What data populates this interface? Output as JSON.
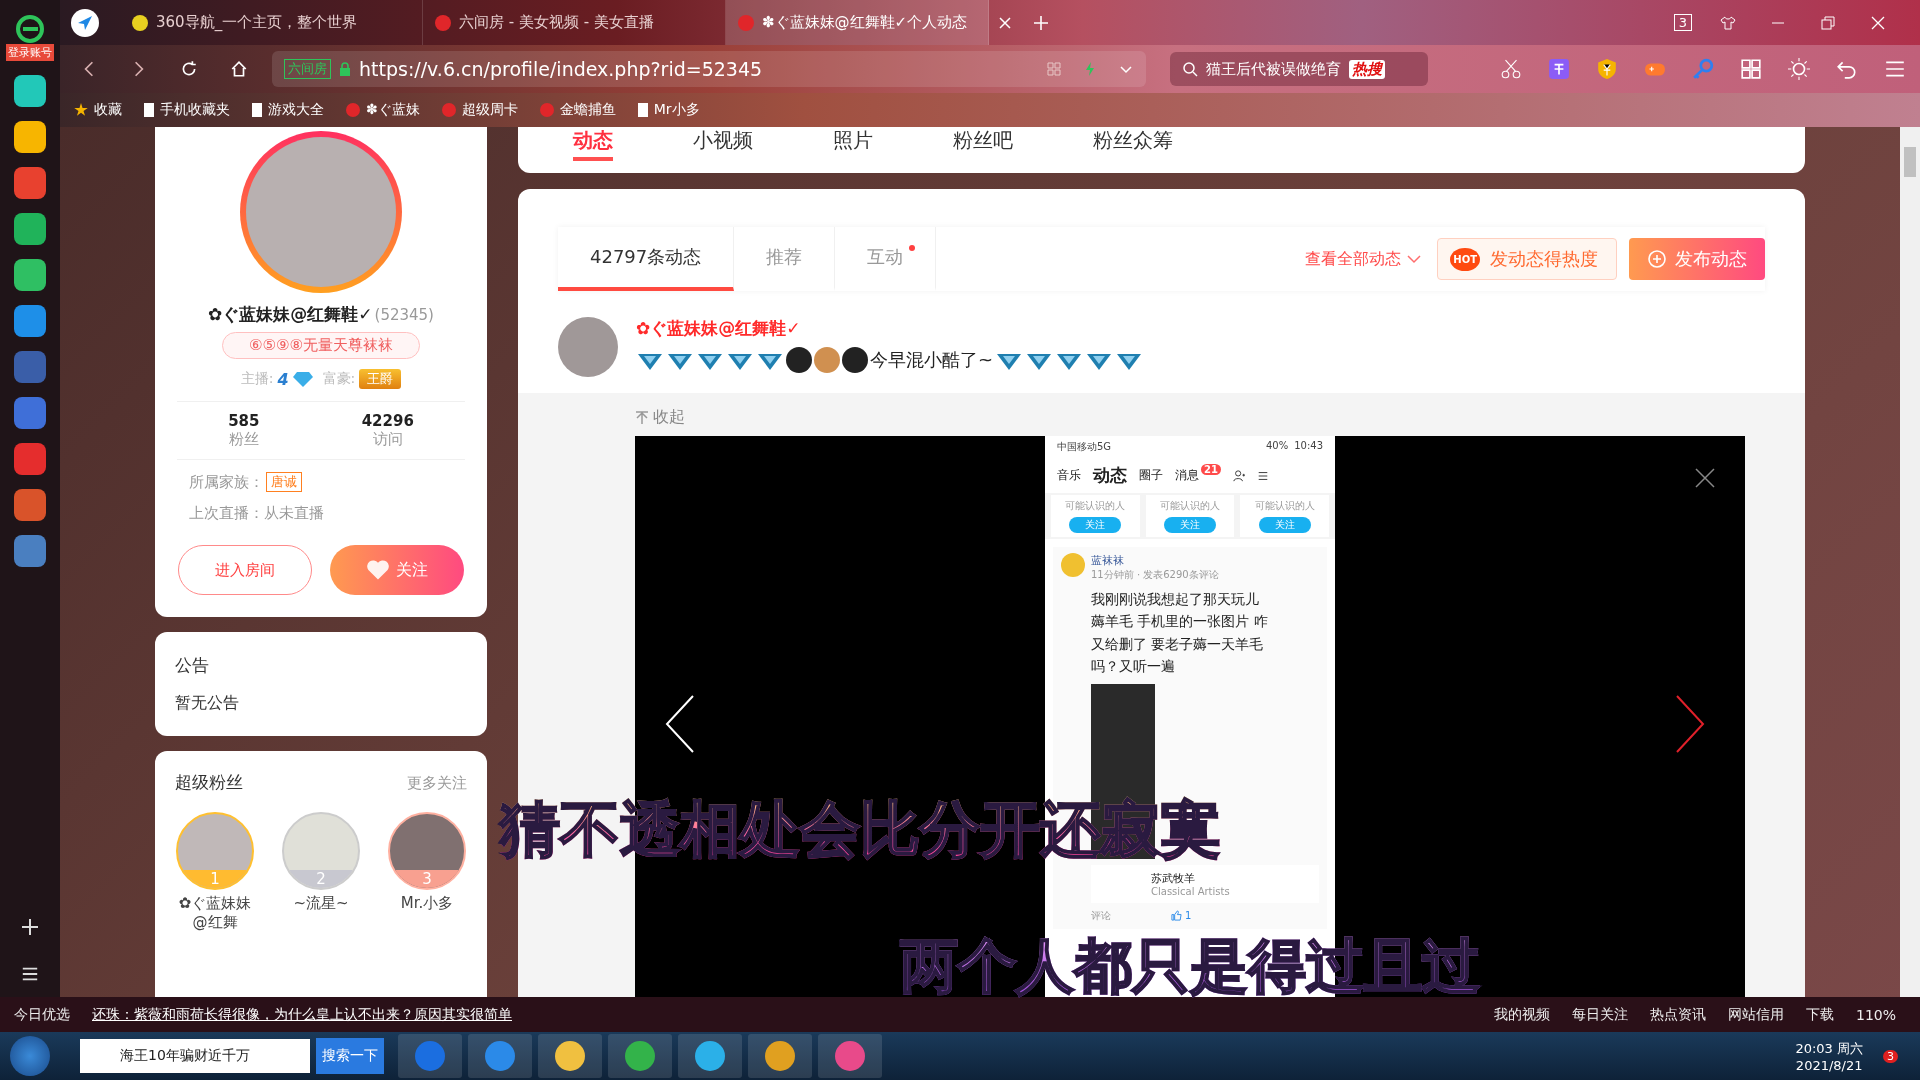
{
  "rail": {
    "login": "登录账号"
  },
  "tabs": [
    {
      "title": "360导航_一个主页，整个世界",
      "selected": false
    },
    {
      "title": "六间房 - 美女视频 - 美女直播",
      "selected": false
    },
    {
      "title": "✽ぐ蓝妹妹@红舞鞋✓个人动态",
      "selected": true
    }
  ],
  "window": {
    "tab_count": "3"
  },
  "address": {
    "cert": "六间房",
    "url": "https://v.6.cn/profile/index.php?rid=52345"
  },
  "search": {
    "value": "猫王后代被误做绝育",
    "hot": "热搜"
  },
  "bookmarks": [
    "收藏",
    "手机收藏夹",
    "游戏大全",
    "✽ぐ蓝妹",
    "超级周卡",
    "金蟾捕鱼",
    "Mr小多"
  ],
  "site_nav": [
    {
      "label": "动态",
      "selected": true
    },
    {
      "label": "小视频",
      "selected": false
    },
    {
      "label": "照片",
      "selected": false
    },
    {
      "label": "粉丝吧",
      "selected": false
    },
    {
      "label": "粉丝众筹",
      "selected": false
    }
  ],
  "profile": {
    "name": "✿ぐ蓝妹妹@红舞鞋✓",
    "id": "(52345)",
    "title": "⑥⑤⑨⑧无量天尊袜袜",
    "anchor_label": "主播:",
    "anchor_level": "4",
    "rich_label": "富豪:",
    "rich_badge": "王爵",
    "stats": [
      {
        "value": "585",
        "label": "粉丝"
      },
      {
        "value": "42296",
        "label": "访问"
      }
    ],
    "family_label": "所属家族：",
    "family": "唐诚",
    "last_live": "上次直播：从未直播",
    "enter": "进入房间",
    "follow": "关注"
  },
  "notice": {
    "title": "公告",
    "body": "暂无公告"
  },
  "fans": {
    "title": "超级粉丝",
    "more": "更多关注",
    "items": [
      {
        "rank": "1",
        "name": "✿ぐ蓝妹妹@红舞"
      },
      {
        "rank": "2",
        "name": "~流星~"
      },
      {
        "rank": "3",
        "name": "Mr.小多"
      }
    ]
  },
  "feed_tabs": [
    {
      "label": "42797条动态",
      "selected": true,
      "dot": false
    },
    {
      "label": "推荐",
      "selected": false,
      "dot": false
    },
    {
      "label": "互动",
      "selected": false,
      "dot": true
    }
  ],
  "feed_actions": {
    "view_all": "查看全部动态",
    "hot_badge": "HOT",
    "hot": "发动态得热度",
    "publish": "发布动态"
  },
  "post": {
    "author": "✿ぐ蓝妹妹@红舞鞋✓",
    "text": "今早混小酷了~",
    "collapse": "收起"
  },
  "phone": {
    "carrier": "中国移动5G",
    "battery": "40%",
    "time": "10:43",
    "tabs": [
      {
        "label": "音乐",
        "selected": false
      },
      {
        "label": "动态",
        "selected": true
      },
      {
        "label": "圈子",
        "selected": false
      },
      {
        "label": "消息",
        "selected": false
      }
    ],
    "badge": "21",
    "suggestions": [
      {
        "hint": "可能认识的人",
        "button": "关注"
      },
      {
        "hint": "可能认识的人",
        "button": "关注"
      },
      {
        "hint": "可能认识的人",
        "button": "关注"
      }
    ],
    "author": "蓝袜袜",
    "meta": "11分钟前 · 发表6290条评论",
    "text_lines": [
      "我刚刚说我想起了那天玩儿",
      "薅羊毛 手机里的一张图片 咋",
      "又给删了 要老子薅一天羊毛",
      "吗？又听一遍"
    ],
    "song": "苏武牧羊",
    "artist": "Classical Artists",
    "comment": "评论",
    "likes": "1"
  },
  "subtitles": [
    "猜不透相处会比分开还寂寞",
    "两个人都只是得过且过"
  ],
  "status_bar": {
    "news_label": "今日优选",
    "headline": "还珠：紫薇和雨荷长得很像，为什么皇上认不出来？原因其实很简单",
    "items": [
      "我的视频",
      "每日关注",
      "热点资讯",
      "网站信用"
    ],
    "download": "下载",
    "zoom": "110%"
  },
  "taskbar": {
    "search_value": "海王10年骗财近千万",
    "search_button": "搜索一下",
    "time": "20:03 周六",
    "date": "2021/8/21",
    "notifications": "3"
  }
}
